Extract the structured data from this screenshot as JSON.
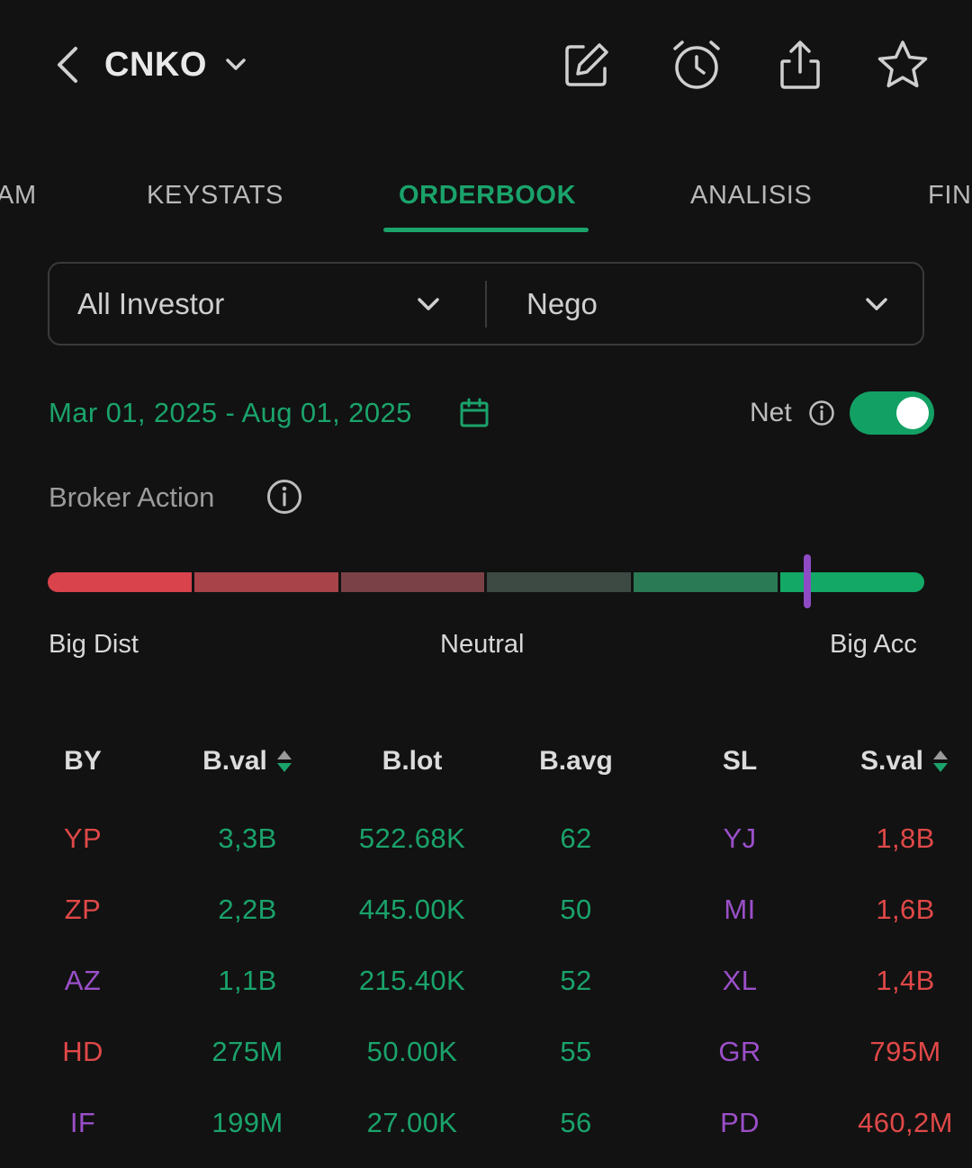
{
  "header": {
    "ticker": "CNKO",
    "icons": [
      "back-chevron-icon",
      "chevron-down-icon",
      "edit-note-icon",
      "alarm-clock-icon",
      "share-icon",
      "star-icon"
    ]
  },
  "tabs": [
    {
      "label": "AM",
      "active": false
    },
    {
      "label": "KEYSTATS",
      "active": false
    },
    {
      "label": "ORDERBOOK",
      "active": true
    },
    {
      "label": "ANALISIS",
      "active": false
    },
    {
      "label": "FIN",
      "active": false
    }
  ],
  "filters": {
    "investor": "All Investor",
    "market": "Nego"
  },
  "date_range": {
    "label": "Mar 01, 2025 - Aug 01, 2025"
  },
  "net_toggle": {
    "label": "Net",
    "on": true
  },
  "broker_action": {
    "title": "Broker Action",
    "scale_left": "Big Dist",
    "scale_mid": "Neutral",
    "scale_right": "Big Acc",
    "marker_level": 0.865,
    "segment_colors": [
      "#d9434c",
      "#a8434a",
      "#7a4246",
      "#3d4a44",
      "#2a7a56",
      "#14a867"
    ]
  },
  "table": {
    "headers": [
      "BY",
      "B.val",
      "B.lot",
      "B.avg",
      "SL",
      "S.val"
    ],
    "rows": [
      {
        "by": "YP",
        "bval": "3,3B",
        "blot": "522.68K",
        "bavg": "62",
        "sl": "YJ",
        "sval": "1,8B",
        "by_color": "red",
        "sl_color": "purple"
      },
      {
        "by": "ZP",
        "bval": "2,2B",
        "blot": "445.00K",
        "bavg": "50",
        "sl": "MI",
        "sval": "1,6B",
        "by_color": "red",
        "sl_color": "purple"
      },
      {
        "by": "AZ",
        "bval": "1,1B",
        "blot": "215.40K",
        "bavg": "52",
        "sl": "XL",
        "sval": "1,4B",
        "by_color": "purple",
        "sl_color": "purple"
      },
      {
        "by": "HD",
        "bval": "275M",
        "blot": "50.00K",
        "bavg": "55",
        "sl": "GR",
        "sval": "795M",
        "by_color": "red",
        "sl_color": "purple"
      },
      {
        "by": "IF",
        "bval": "199M",
        "blot": "27.00K",
        "bavg": "56",
        "sl": "PD",
        "sval": "460,2M",
        "by_color": "purple",
        "sl_color": "purple"
      }
    ]
  },
  "colors": {
    "background": "#121212",
    "accent_green": "#1aa36b",
    "red": "#e04848",
    "purple": "#9b4fc9"
  }
}
